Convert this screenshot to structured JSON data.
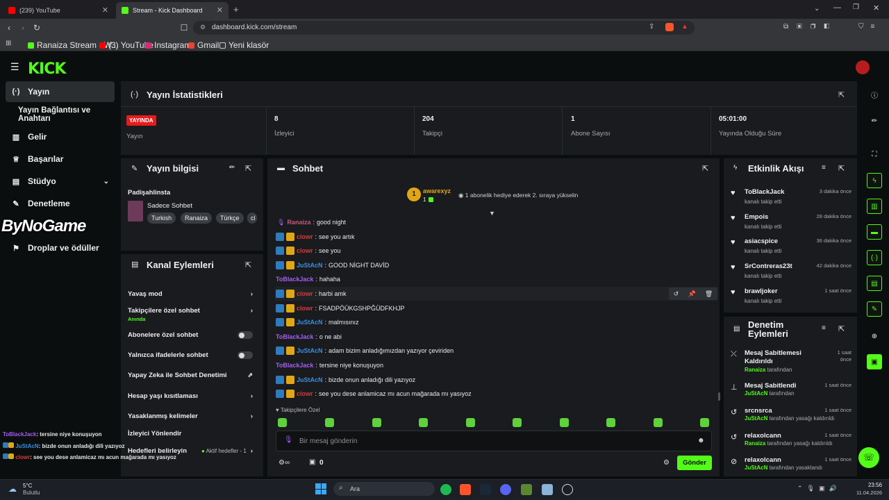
{
  "browser": {
    "tabs": [
      {
        "label": "(239) YouTube",
        "color": "#ff0000"
      },
      {
        "label": "Stream - Kick Dashboard",
        "color": "#53fc18"
      }
    ],
    "url": "dashboard.kick.com/stream",
    "bookmarks": [
      "Ranaiza Stream - W...",
      "(3) YouTube",
      "Instagram",
      "Gmail",
      "Yeni klasör"
    ]
  },
  "brand": {
    "logo": "KICK",
    "accent": "#53fc18"
  },
  "sidebar": {
    "items": [
      {
        "label": "Yayın",
        "icon": "broadcast-icon"
      },
      {
        "label": "Yayın Bağlantısı ve Anahtarı",
        "icon": ""
      },
      {
        "label": "Gelir",
        "icon": "chart-icon"
      },
      {
        "label": "Başarılar",
        "icon": "trophy-icon"
      },
      {
        "label": "Stüdyo",
        "icon": "studio-icon"
      },
      {
        "label": "Denetleme",
        "icon": "wrench-icon"
      },
      {
        "label": "Droplar ve ödüller",
        "icon": "gift-icon"
      }
    ],
    "overlay_text": "ByNoGame"
  },
  "stats": {
    "title": "Yayın İstatistikleri",
    "live_badge": "YAYINDA",
    "live_label": "Yayın",
    "items": [
      {
        "value": "8",
        "label": "İzleyici"
      },
      {
        "value": "204",
        "label": "Takipçi"
      },
      {
        "value": "1",
        "label": "Abone Sayısı"
      },
      {
        "value": "05:01:00",
        "label": "Yayında Olduğu Süre"
      }
    ]
  },
  "stream_info": {
    "title": "Yayın bilgisi",
    "stream_title": "Padişahlinsta",
    "category": "Sadece Sohbet",
    "tags": [
      "Turkish",
      "Ranaiza",
      "Türkçe",
      "cl"
    ]
  },
  "channel_actions": {
    "title": "Kanal Eylemleri",
    "items": [
      {
        "label": "Yavaş mod",
        "control": "chevron"
      },
      {
        "label": "Takipçilere özel sohbet",
        "sub": "Anında",
        "control": "chevron"
      },
      {
        "label": "Abonelere özel sohbet",
        "control": "toggle"
      },
      {
        "label": "Yalnızca ifadelerle sohbet",
        "control": "toggle"
      },
      {
        "label": "Yapay Zeka ile Sohbet Denetimi",
        "control": "external"
      },
      {
        "label": "Hesap yaşı kısıtlaması",
        "control": "chevron"
      },
      {
        "label": "Yasaklanmış kelimeler",
        "control": "chevron"
      },
      {
        "label": "İzleyici Yönlendir",
        "control": "none"
      },
      {
        "label": "Hedefleri belirleyin",
        "extra": "Aktif hedefler - 1",
        "control": "chevron"
      }
    ]
  },
  "chat": {
    "title": "Sohbet",
    "pinned_user": "awarexyz",
    "pinned_rank": "1",
    "pinned_count": "1",
    "pinned_text": "1 abonelik hediye ederek 2. sıraya yükselin",
    "messages": [
      {
        "user": "Ranaiza",
        "text": "good night",
        "cls": "u-pink",
        "badges": 0
      },
      {
        "user": "clowr",
        "text": "see you artık",
        "cls": "u-red",
        "badges": 2
      },
      {
        "user": "clowr",
        "text": "see you",
        "cls": "u-red",
        "badges": 2
      },
      {
        "user": "JuStAcN",
        "text": "GOOD NİGHT DAVİD",
        "cls": "u-blue",
        "badges": 2
      },
      {
        "user": "ToBlackJack",
        "text": "hahaha",
        "cls": "u-purp",
        "badges": 0
      },
      {
        "user": "clowr",
        "text": "harbi amk",
        "cls": "u-red",
        "badges": 2
      },
      {
        "user": "clowr",
        "text": "FSADPÖÜKGSHPĞÜDFKHJP",
        "cls": "u-red",
        "badges": 2
      },
      {
        "user": "JuStAcN",
        "text": "malmısınız",
        "cls": "u-blue",
        "badges": 2
      },
      {
        "user": "ToBlackJack",
        "text": "o ne abi",
        "cls": "u-purp",
        "badges": 0
      },
      {
        "user": "JuStAcN",
        "text": "adam bizim anladığımızdan yazıyor çeviriden",
        "cls": "u-blue",
        "badges": 2
      },
      {
        "user": "ToBlackJack",
        "text": "tersine niye konuşuyon",
        "cls": "u-purp",
        "badges": 0
      },
      {
        "user": "JuStAcN",
        "text": "bizde onun anladığı dili yazıyoz",
        "cls": "u-blue",
        "badges": 2
      },
      {
        "user": "clowr",
        "text": "see you dese anlamicaz mı acun mağarada mı yasıyoz",
        "cls": "u-red",
        "badges": 2
      }
    ],
    "follower_only": "Takipçilere Özel",
    "input_placeholder": "Bir mesaj gönderin",
    "points": "0",
    "send": "Gönder"
  },
  "activity": {
    "title": "Etkinlik Akışı",
    "items": [
      {
        "name": "ToBlackJack",
        "sub": "kanalı takip etti",
        "time": "3 dakika önce"
      },
      {
        "name": "Empois",
        "sub": "kanalı takip etti",
        "time": "28 dakika önce"
      },
      {
        "name": "asiacspice",
        "sub": "kanalı takip etti",
        "time": "36 dakika önce"
      },
      {
        "name": "SrContreras23t",
        "sub": "kanalı takip etti",
        "time": "42 dakika önce"
      },
      {
        "name": "brawljoker",
        "sub": "kanalı takip etti",
        "time": "1 saat önce"
      }
    ]
  },
  "mod_actions": {
    "title": "Denetim Eylemleri",
    "items": [
      {
        "name": "Mesaj Sabitlemesi Kaldırıldı",
        "by": "Ranaiza",
        "suffix": "tarafından",
        "time": "1 saat önce"
      },
      {
        "name": "Mesaj Sabitlendi",
        "by": "JuStAcN",
        "suffix": "tarafından",
        "time": "1 saat önce"
      },
      {
        "name": "srcnsrca",
        "by": "JuStAcN",
        "suffix": "tarafından yasağı kaldırıldı",
        "time": "1 saat önce"
      },
      {
        "name": "relaxolcann",
        "by": "Ranaiza",
        "suffix": "tarafından yasağı kaldırıldı",
        "time": "1 saat önce"
      },
      {
        "name": "relaxolcann",
        "by": "JuStAcN",
        "suffix": "tarafından yasaklandı",
        "time": "1 saat önce"
      }
    ]
  },
  "overlay_chat": [
    {
      "user": "ToBlackJack",
      "text": ": tersine niye konuşuyon"
    },
    {
      "user": "JuStAcN",
      "text": ": bizde onun anladığı dili yazıyoz"
    },
    {
      "user": "clowr",
      "text": ": see you dese anlamicaz mı acun mağarada mı yasıyoz"
    }
  ],
  "taskbar": {
    "weather_temp": "5°C",
    "weather_label": "Bulutlu",
    "search": "Ara",
    "time": "23:56",
    "date": "11.04.2026"
  }
}
